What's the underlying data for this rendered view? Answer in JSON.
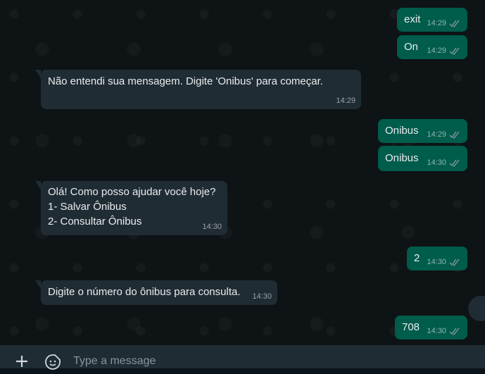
{
  "messages": [
    {
      "id": "m1",
      "dir": "out",
      "text": "exit",
      "time": "14:29"
    },
    {
      "id": "m2",
      "dir": "out",
      "text": "On",
      "time": "14:29"
    },
    {
      "id": "m3",
      "dir": "in",
      "text": "Não entendi sua mensagem. Digite 'Onibus' para começar.",
      "time": "14:29"
    },
    {
      "id": "m4",
      "dir": "out",
      "text": "Onibus",
      "time": "14:29"
    },
    {
      "id": "m5",
      "dir": "out",
      "text": "Onibus",
      "time": "14:30"
    },
    {
      "id": "m6",
      "dir": "in",
      "text": "Olá! Como posso ajudar você hoje?\n1- Salvar Ônibus\n2- Consultar Ônibus",
      "time": "14:30"
    },
    {
      "id": "m7",
      "dir": "out",
      "text": "2",
      "time": "14:30"
    },
    {
      "id": "m8",
      "dir": "in",
      "text": "Digite o número do ônibus para consulta.",
      "time": "14:30"
    },
    {
      "id": "m9",
      "dir": "out",
      "text": "708",
      "time": "14:30"
    }
  ],
  "composer": {
    "placeholder": "Type a message",
    "attach_icon": "plus-icon",
    "sticker_icon": "sticker-icon"
  },
  "colors": {
    "background": "#0e1315",
    "incoming": "#202c33",
    "outgoing": "#005c4b",
    "text": "#e9edef",
    "meta": "#8696a0"
  }
}
